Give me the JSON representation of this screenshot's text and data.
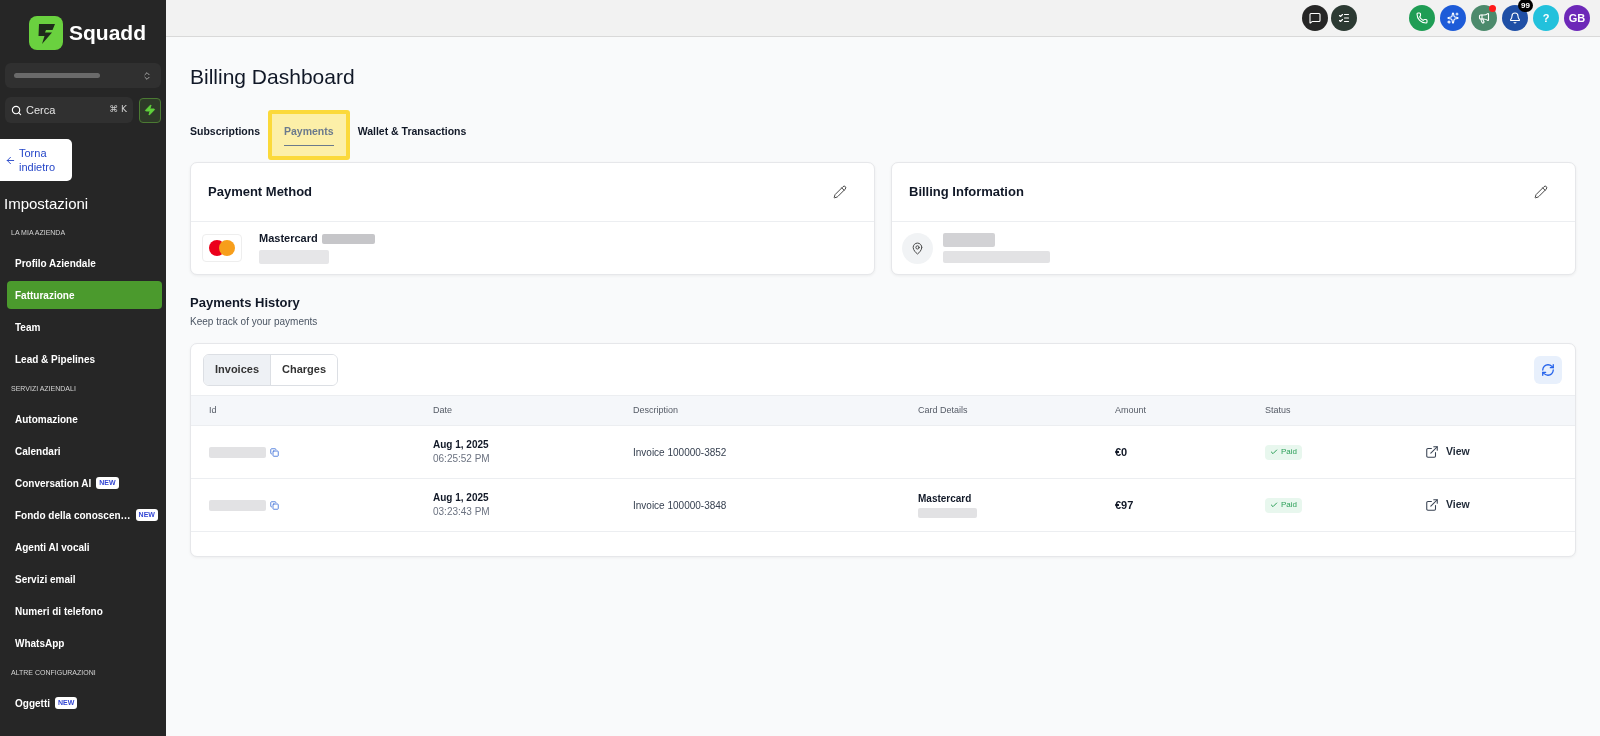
{
  "sidebar": {
    "brand": "Squadd",
    "search": {
      "placeholder": "Cerca",
      "shortcut": "⌘ K"
    },
    "back_link": "Torna indietro",
    "title": "Impostazioni",
    "sections": [
      {
        "heading": "LA MIA AZIENDA",
        "items": [
          {
            "label": "Profilo Aziendale",
            "selected": false
          },
          {
            "label": "Fatturazione",
            "selected": true
          },
          {
            "label": "Team",
            "selected": false
          },
          {
            "label": "Lead & Pipelines",
            "selected": false
          }
        ]
      },
      {
        "heading": "SERVIZI AZIENDALI",
        "items": [
          {
            "label": "Automazione",
            "selected": false
          },
          {
            "label": "Calendari",
            "selected": false
          },
          {
            "label": "Conversation AI",
            "badge": "NEW",
            "selected": false
          },
          {
            "label": "Fondo della conoscen…",
            "badge": "NEW",
            "selected": false
          },
          {
            "label": "Agenti AI vocali",
            "selected": false
          },
          {
            "label": "Servizi email",
            "selected": false
          },
          {
            "label": "Numeri di telefono",
            "selected": false
          },
          {
            "label": "WhatsApp",
            "selected": false
          }
        ]
      },
      {
        "heading": "ALTRE CONFIGURAZIONI",
        "items": [
          {
            "label": "Oggetti",
            "badge": "NEW",
            "selected": false
          }
        ]
      }
    ]
  },
  "topbar": {
    "buttons": [
      {
        "kind": "chat"
      },
      {
        "kind": "tasks"
      },
      {
        "kind": "phone"
      },
      {
        "kind": "ai"
      },
      {
        "kind": "announcements",
        "alert": true
      },
      {
        "kind": "notifications",
        "badge": "99"
      },
      {
        "kind": "help",
        "label": "?"
      },
      {
        "kind": "avatar",
        "label": "GB"
      }
    ]
  },
  "page": {
    "title": "Billing Dashboard",
    "tabs": [
      {
        "label": "Subscriptions",
        "selected": false,
        "highlighted": false
      },
      {
        "label": "Payments",
        "selected": true,
        "highlighted": true
      },
      {
        "label": "Wallet & Transactions",
        "selected": false,
        "highlighted": false
      }
    ],
    "payment_method": {
      "title": "Payment Method",
      "card_brand": "Mastercard"
    },
    "billing_information": {
      "title": "Billing Information"
    },
    "payments_history": {
      "title": "Payments History",
      "subtitle": "Keep track of your payments",
      "views": [
        {
          "label": "Invoices",
          "selected": true
        },
        {
          "label": "Charges",
          "selected": false
        }
      ],
      "table": {
        "columns": [
          "Id",
          "Date",
          "Description",
          "Card Details",
          "Amount",
          "Status"
        ],
        "rows": [
          {
            "date": "Aug 1, 2025",
            "time": "06:25:52 PM",
            "description": "Invoice 100000-3852",
            "amount": "€0",
            "status": "Paid",
            "action": "View"
          },
          {
            "date": "Aug 1, 2025",
            "time": "03:23:43 PM",
            "description": "Invoice 100000-3848",
            "card_brand": "Mastercard",
            "amount": "€97",
            "status": "Paid",
            "action": "View"
          }
        ]
      }
    }
  }
}
